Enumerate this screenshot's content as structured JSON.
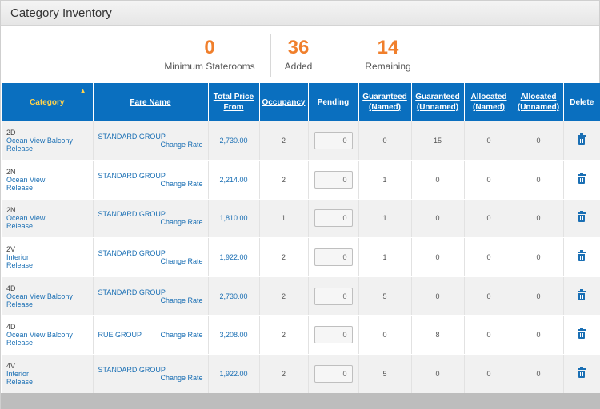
{
  "panel": {
    "title": "Category Inventory"
  },
  "stats": [
    {
      "value": "0",
      "label": "Minimum Staterooms"
    },
    {
      "value": "36",
      "label": "Added"
    },
    {
      "value": "14",
      "label": "Remaining"
    }
  ],
  "table": {
    "headers": {
      "category": "Category",
      "fare_name": "Fare Name",
      "total_price_1": "Total Price",
      "total_price_2": "From",
      "occupancy": "Occupancy",
      "pending": "Pending",
      "g_named_1": "Guaranteed",
      "g_named_2": "(Named)",
      "g_unnamed_1": "Guaranteed",
      "g_unnamed_2": "(Unnamed)",
      "a_named_1": "Allocated",
      "a_named_2": "(Named)",
      "a_unnamed_1": "Allocated",
      "a_unnamed_2": "(Unnamed)",
      "delete": "Delete"
    },
    "sort_indicator": "▲",
    "change_rate_label": "Change Rate",
    "rows": [
      {
        "code": "2D",
        "name": "Ocean View Balcony",
        "release": "Release",
        "fare": "STANDARD GROUP",
        "price": "2,730.00",
        "occupancy": "2",
        "pending": "0",
        "g_named": "0",
        "g_unnamed": "15",
        "a_named": "0",
        "a_unnamed": "0"
      },
      {
        "code": "2N",
        "name": "Ocean View",
        "release": "Release",
        "fare": "STANDARD GROUP",
        "price": "2,214.00",
        "occupancy": "2",
        "pending": "0",
        "g_named": "1",
        "g_unnamed": "0",
        "a_named": "0",
        "a_unnamed": "0"
      },
      {
        "code": "2N",
        "name": "Ocean View",
        "release": "Release",
        "fare": "STANDARD GROUP",
        "price": "1,810.00",
        "occupancy": "1",
        "pending": "0",
        "g_named": "1",
        "g_unnamed": "0",
        "a_named": "0",
        "a_unnamed": "0"
      },
      {
        "code": "2V",
        "name": "Interior",
        "release": "Release",
        "fare": "STANDARD GROUP",
        "price": "1,922.00",
        "occupancy": "2",
        "pending": "0",
        "g_named": "1",
        "g_unnamed": "0",
        "a_named": "0",
        "a_unnamed": "0"
      },
      {
        "code": "4D",
        "name": "Ocean View Balcony",
        "release": "Release",
        "fare": "STANDARD GROUP",
        "price": "2,730.00",
        "occupancy": "2",
        "pending": "0",
        "g_named": "5",
        "g_unnamed": "0",
        "a_named": "0",
        "a_unnamed": "0"
      },
      {
        "code": "4D",
        "name": "Ocean View Balcony",
        "release": "Release",
        "fare": "RUE GROUP",
        "price": "3,208.00",
        "occupancy": "2",
        "pending": "0",
        "g_named": "0",
        "g_unnamed": "8",
        "a_named": "0",
        "a_unnamed": "0"
      },
      {
        "code": "4V",
        "name": "Interior",
        "release": "Release",
        "fare": "STANDARD GROUP",
        "price": "1,922.00",
        "occupancy": "2",
        "pending": "0",
        "g_named": "5",
        "g_unnamed": "0",
        "a_named": "0",
        "a_unnamed": "0"
      }
    ]
  },
  "colors": {
    "header_blue": "#0a6fbf",
    "accent_orange": "#f07f2c",
    "link_blue": "#1a6fb4"
  },
  "icons": {
    "delete": "trash-icon"
  }
}
